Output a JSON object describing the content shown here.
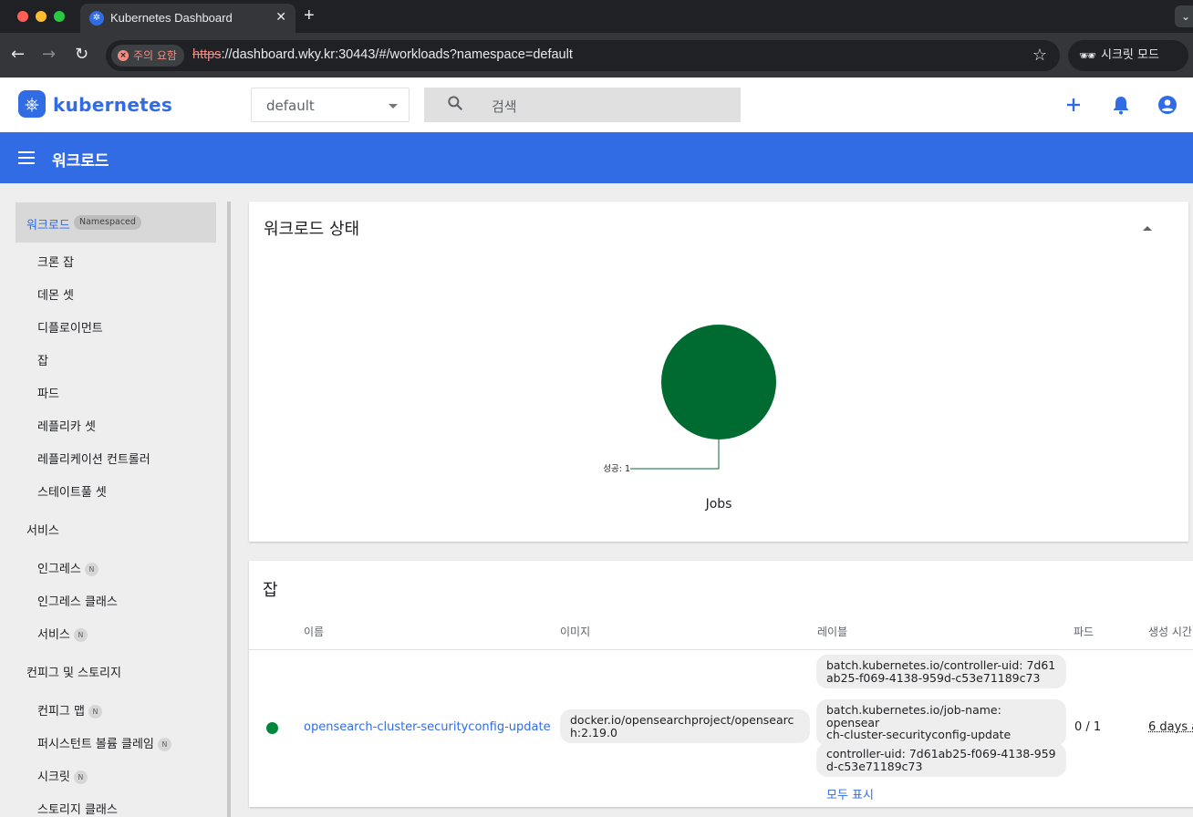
{
  "browser": {
    "tab_title": "Kubernetes Dashboard",
    "tab_close": "✕",
    "new_tab": "+",
    "security_chip": "주의 요함",
    "url_scheme": "https",
    "url_rest": "://dashboard.wky.kr:30443/#/workloads?namespace=default",
    "incognito_label": "시크릿 모드"
  },
  "header": {
    "logo_text": "kubernetes",
    "namespace": "default",
    "search_placeholder": "검색"
  },
  "toolbar": {
    "title": "워크로드"
  },
  "sidebar": {
    "active_item": "워크로드",
    "active_badge": "Namespaced",
    "workload_items": [
      "크론 잡",
      "데몬 셋",
      "디플로이먼트",
      "잡",
      "파드",
      "레플리카 셋",
      "레플리케이션 컨트롤러",
      "스테이트풀 셋"
    ],
    "service_section": "서비스",
    "service_items": [
      "인그레스",
      "인그레스 클래스",
      "서비스"
    ],
    "config_section": "컨피그 및 스토리지",
    "config_items": [
      "컨피그 맵",
      "퍼시스턴트 볼륨 클레임",
      "시크릿",
      "스토리지 클래스"
    ],
    "n_badge": "N"
  },
  "status_card": {
    "title": "워크로드 상태",
    "chart_title": "Jobs",
    "slice_label": "성공: 1"
  },
  "chart_data": {
    "type": "pie",
    "title": "Jobs",
    "categories": [
      "성공"
    ],
    "values": [
      1
    ],
    "colors": [
      "#006b31"
    ]
  },
  "jobs_card": {
    "title": "잡",
    "columns": [
      "이름",
      "이미지",
      "레이블",
      "파드",
      "생성 시간"
    ],
    "rows": [
      {
        "status_color": "#00873d",
        "name": "opensearch-cluster-securityconfig-update",
        "image_line1": "docker.io/opensearchproject/opensearc",
        "image_line2": "h:2.19.0",
        "labels": [
          {
            "line1": "batch.kubernetes.io/controller-uid: 7d61",
            "line2": "ab25-f069-4138-959d-c53e71189c73"
          },
          {
            "line1": "batch.kubernetes.io/job-name: opensear",
            "line2": "ch-cluster-securityconfig-update"
          },
          {
            "line1": "controller-uid: 7d61ab25-f069-4138-959",
            "line2": "d-c53e71189c73"
          }
        ],
        "pods": "0 / 1",
        "age": "6 days a",
        "show_all": "모두 표시"
      }
    ]
  }
}
